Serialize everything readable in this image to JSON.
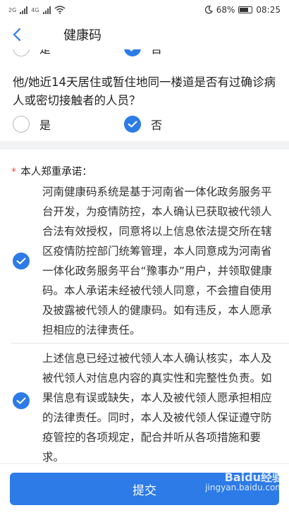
{
  "status": {
    "signal_label_1": "2G",
    "signal_label_2": "4G",
    "battery": "68%",
    "time": "08:25"
  },
  "nav": {
    "title": "健康码"
  },
  "prev_question": {
    "option_yes": "是",
    "option_no": "否",
    "selected": "no"
  },
  "question": {
    "text": "他/她近14天居住或暂住地同一楼道是否有过确诊病人或密切接触者的人员？",
    "option_yes": "是",
    "option_no": "否",
    "selected": "no"
  },
  "pledge": {
    "star": "*",
    "title": "本人郑重承诺：",
    "items": [
      {
        "checked": true,
        "text": "河南健康码系统是基于河南省一体化政务服务平台开发，为疫情防控，本人确认已获取被代领人合法有效授权，同意将以上信息依法提交所在辖区疫情防控部门统筹管理，本人同意成为河南省一体化政务服务平台“豫事办”用户，并领取健康码。本人承诺未经被代领人同意，不会擅自使用及披露被代领人的健康码。如有违反，本人愿承担相应的法律责任。"
      },
      {
        "checked": true,
        "text": "上述信息已经过被代领人本人确认核实，本人及被代领人对信息内容的真实性和完整性负责。如果信息有误或缺失，本人及被代领人愿承担相应的法律责任。同时，本人及被代领人保证遵守防疫管控的各项规定，配合并听从各项措施和要求。"
      }
    ]
  },
  "footer": {
    "submit_label": "提交"
  },
  "watermark": {
    "brand": "Baidu经验",
    "url": "jingyan.baidu.com"
  },
  "colors": {
    "accent": "#2d7be6",
    "required_star": "#e8502b"
  }
}
